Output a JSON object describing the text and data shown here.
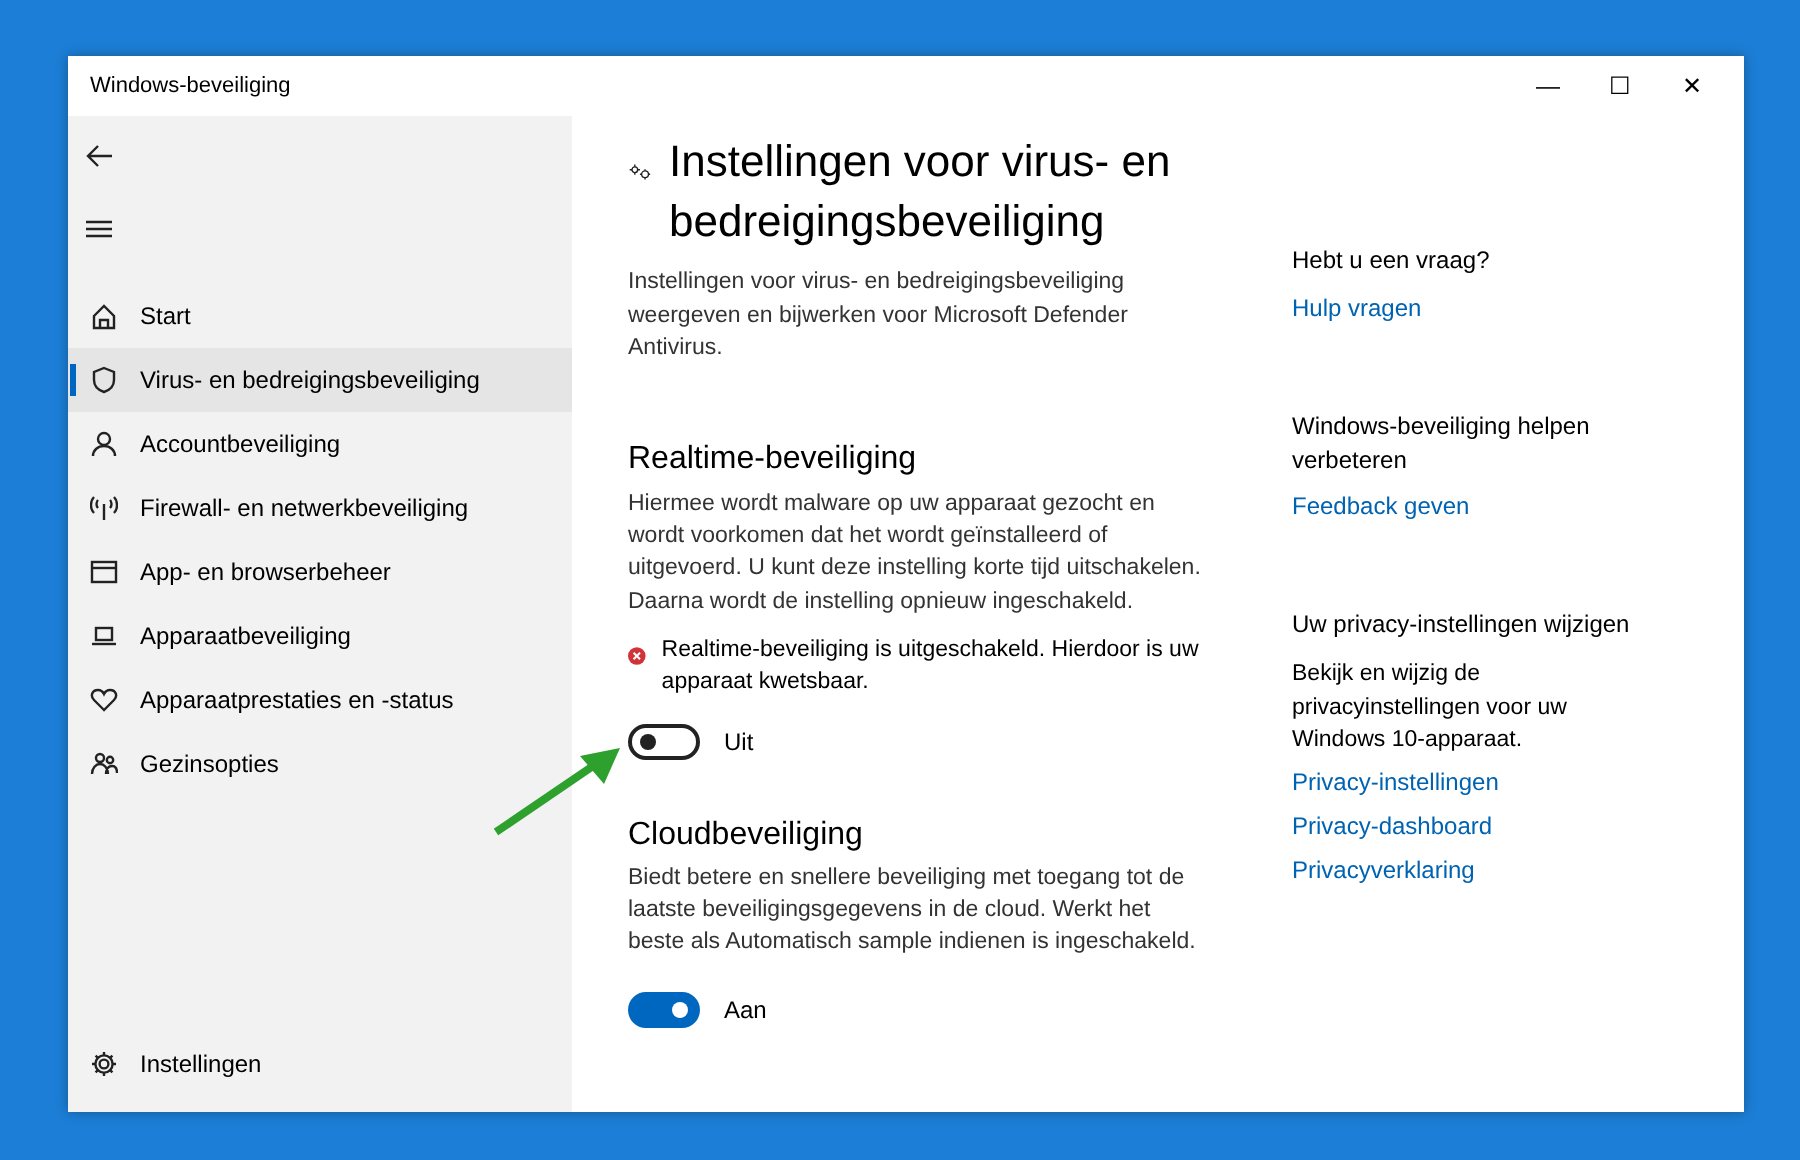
{
  "window": {
    "title": "Windows-beveiliging",
    "controls": [
      "—",
      "☐",
      "✕"
    ]
  },
  "sidebar": {
    "items": [
      {
        "label": "Start",
        "selected": false
      },
      {
        "label": "Virus- en bedreigingsbeveiliging",
        "selected": true
      },
      {
        "label": "Accountbeveiliging",
        "selected": false
      },
      {
        "label": "Firewall- en netwerkbeveiliging",
        "selected": false
      },
      {
        "label": "App- en browserbeheer",
        "selected": false
      },
      {
        "label": "Apparaatbeveiliging",
        "selected": false
      },
      {
        "label": "Apparaatprestaties en -status",
        "selected": false
      },
      {
        "label": "Gezinsopties",
        "selected": false
      }
    ],
    "settings": {
      "label": "Instellingen"
    }
  },
  "main": {
    "title": "Instellingen voor virus- en bedreigingsbeveiliging",
    "description": "Instellingen voor virus- en bedreigingsbeveiliging weergeven en bijwerken voor Microsoft Defender Antivirus.",
    "sections": [
      {
        "heading": "Realtime-beveiliging",
        "text": "Hiermee wordt malware op uw apparaat gezocht en wordt voorkomen dat het wordt geïnstalleerd of uitgevoerd. U kunt deze instelling korte tijd uitschakelen. Daarna wordt de instelling opnieuw ingeschakeld.",
        "warning": "Realtime-beveiliging is uitgeschakeld. Hierdoor is uw apparaat kwetsbaar.",
        "toggle": {
          "on": false,
          "label": "Uit"
        }
      },
      {
        "heading": "Cloudbeveiliging",
        "text": "Biedt betere en snellere beveiliging met toegang tot de laatste beveiligingsgegevens in de cloud. Werkt het beste als Automatisch sample indienen is ingeschakeld.",
        "toggle": {
          "on": true,
          "label": "Aan"
        }
      }
    ]
  },
  "aside": [
    {
      "heading": "Hebt u een vraag?",
      "links": [
        "Hulp vragen"
      ]
    },
    {
      "heading": "Windows-beveiliging helpen verbeteren",
      "links": [
        "Feedback geven"
      ]
    },
    {
      "heading": "Uw privacy-instellingen wijzigen",
      "text": "Bekijk en wijzig de privacyinstellingen voor uw Windows 10-apparaat.",
      "links": [
        "Privacy-instellingen",
        "Privacy-dashboard",
        "Privacyverklaring"
      ]
    }
  ],
  "annotation": {
    "kind": "arrow"
  }
}
